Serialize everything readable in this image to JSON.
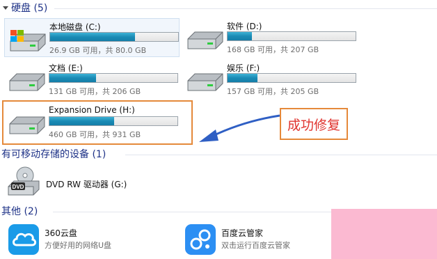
{
  "groups": {
    "hard_disks": "硬盘 (5)",
    "removable": "有可移动存储的设备 (1)",
    "other": "其他 (2)"
  },
  "drives": [
    {
      "name": "本地磁盘 (C:)",
      "space": "26.9 GB 可用，共 80.0 GB",
      "used_fraction": 0.664,
      "icon": "windows-drive-icon",
      "selected": true
    },
    {
      "name": "软件 (D:)",
      "space": "168 GB 可用，共 207 GB",
      "used_fraction": 0.188,
      "icon": "hard-drive-icon"
    },
    {
      "name": "文档 (E:)",
      "space": "131 GB 可用，共 206 GB",
      "used_fraction": 0.364,
      "icon": "hard-drive-icon"
    },
    {
      "name": "娱乐 (F:)",
      "space": "157 GB 可用，共 205 GB",
      "used_fraction": 0.234,
      "icon": "hard-drive-icon"
    },
    {
      "name": "Expansion Drive (H:)",
      "space": "460 GB 可用，共 931 GB",
      "used_fraction": 0.506,
      "icon": "hard-drive-icon"
    }
  ],
  "removable_devices": [
    {
      "name": "DVD RW 驱动器 (G:)",
      "icon": "dvd-drive-icon",
      "icon_text": "DVD"
    }
  ],
  "other_items": [
    {
      "name": "360云盘",
      "desc": "方便好用的网络U盘",
      "icon": "cloud-icon",
      "color": "#1a9be8"
    },
    {
      "name": "百度云管家",
      "desc": "双击运行百度云管家",
      "icon": "baidu-cloud-icon",
      "color": "#2c8ff3"
    }
  ],
  "annotation": {
    "callout_text": "成功修复",
    "color": "#e5893a",
    "text_color": "#e0342f",
    "arrow_color": "#2f5fc4"
  },
  "colors": {
    "group_title": "#1e3287",
    "bar_fill": "#1b8bb5"
  }
}
